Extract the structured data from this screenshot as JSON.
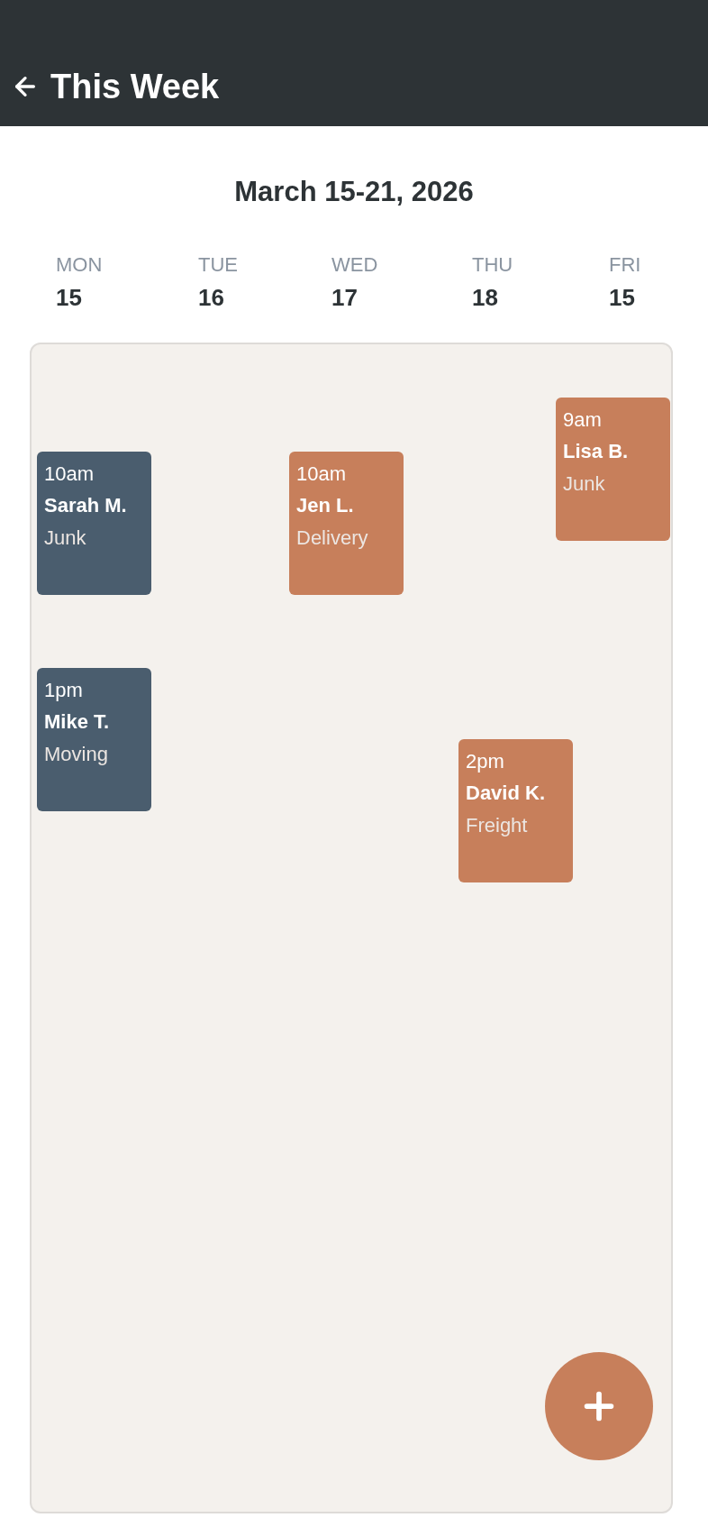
{
  "header": {
    "title": "This Week"
  },
  "week": {
    "range": "March 15-21, 2026"
  },
  "days": [
    {
      "name": "MON",
      "date": "15",
      "events": [
        {
          "time": "10am",
          "customer": "Sarah M.",
          "service": "Junk",
          "color": "#4a5d6e"
        },
        {
          "time": "1pm",
          "customer": "Mike T.",
          "service": "Moving",
          "color": "#4a5d6e"
        }
      ]
    },
    {
      "name": "TUE",
      "date": "16"
    },
    {
      "name": "WED",
      "date": "17",
      "events": [
        {
          "time": "10am",
          "customer": "Jen L.",
          "service": "Delivery",
          "color": "#c77f5b"
        }
      ]
    },
    {
      "name": "THU",
      "date": "18",
      "events": [
        {
          "time": "2pm",
          "customer": "David K.",
          "service": "Freight",
          "color": "#c77f5b"
        }
      ]
    },
    {
      "name": "FRI",
      "date": "15",
      "events": [
        {
          "time": "9am",
          "customer": "Lisa B.",
          "service": "Junk",
          "color": "#c77f5b"
        }
      ]
    }
  ]
}
